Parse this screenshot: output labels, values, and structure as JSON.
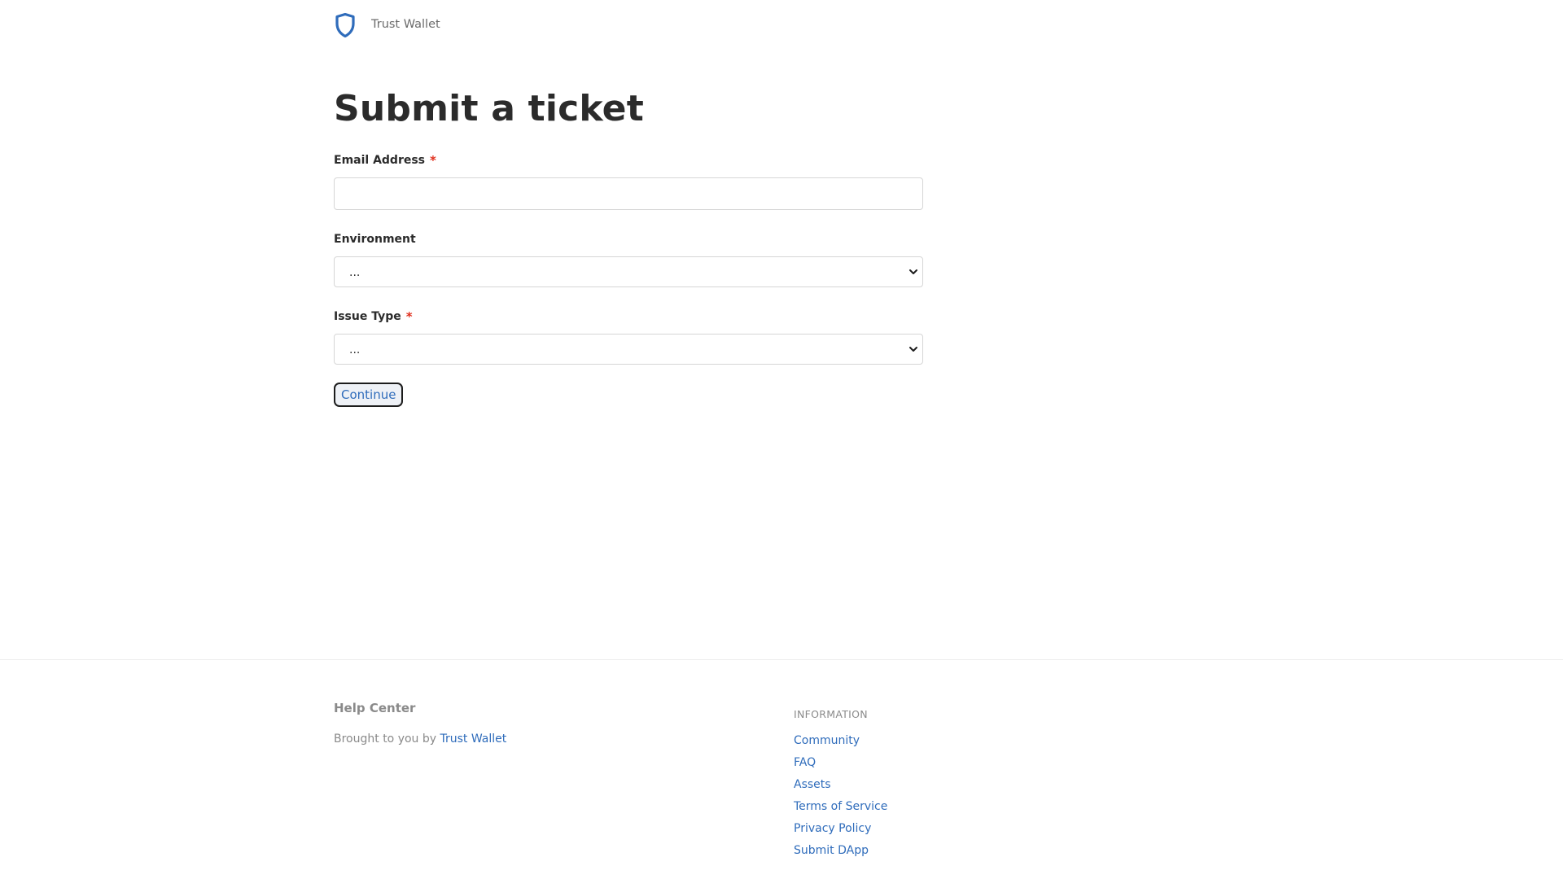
{
  "header": {
    "brand_name": "Trust Wallet"
  },
  "main": {
    "title": "Submit a ticket",
    "form": {
      "email": {
        "label": "Email Address",
        "required_mark": "*",
        "value": "",
        "placeholder": ""
      },
      "environment": {
        "label": "Environment",
        "selected": "..."
      },
      "issue_type": {
        "label": "Issue Type",
        "required_mark": "*",
        "selected": "..."
      },
      "continue_label": "Continue"
    }
  },
  "footer": {
    "title": "Help Center",
    "credit_prefix": "Brought to you by",
    "credit_link": "Trust Wallet",
    "information": {
      "heading": "INFORMATION",
      "links": [
        "Community",
        "FAQ",
        "Assets",
        "Terms of Service",
        "Privacy Policy",
        "Submit DApp"
      ]
    }
  },
  "colors": {
    "accent": "#2f6cbb",
    "required": "#e0301e",
    "muted": "#8a8a8a"
  }
}
